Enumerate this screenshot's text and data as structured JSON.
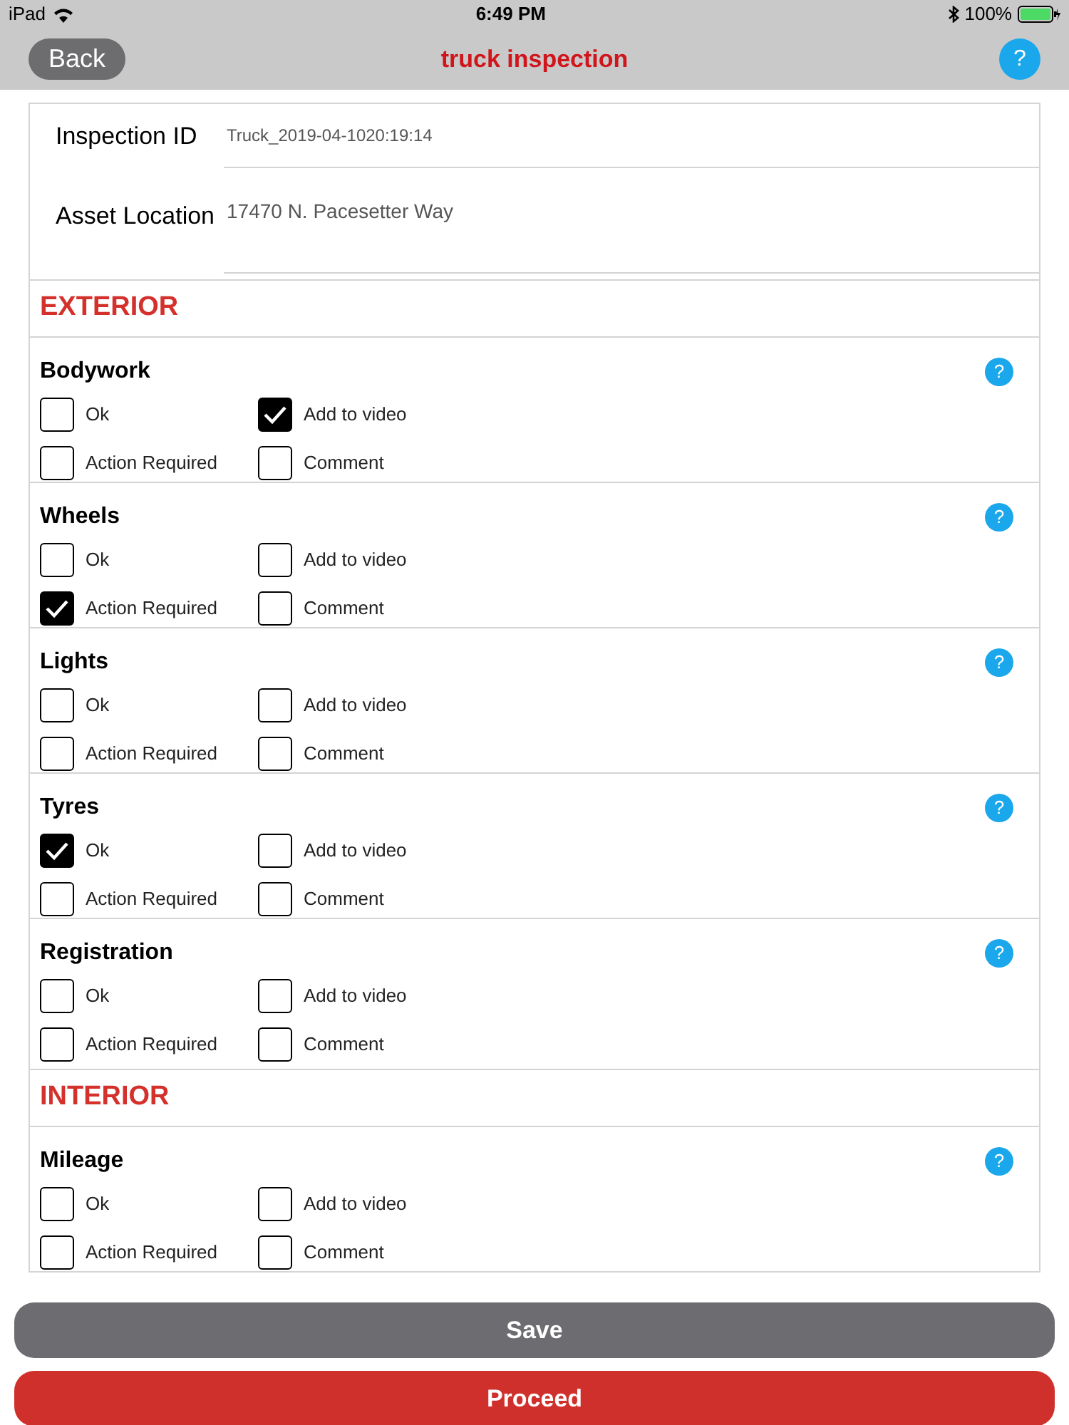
{
  "status_bar": {
    "device": "iPad",
    "time": "6:49 PM",
    "battery": "100%"
  },
  "nav": {
    "back": "Back",
    "title": "truck inspection",
    "help": "?"
  },
  "fields": [
    {
      "label": "Inspection ID",
      "value": "Truck_2019-04-1020:19:14"
    },
    {
      "label": "Asset Location",
      "value": "17470 N. Pacesetter Way"
    }
  ],
  "sections": [
    {
      "title": "EXTERIOR",
      "items": [
        {
          "name": "Bodywork",
          "help": "?",
          "options": [
            {
              "label": "Ok",
              "checked": false
            },
            {
              "label": "Add to video",
              "checked": true
            },
            {
              "label": "Action Required",
              "checked": false
            },
            {
              "label": "Comment",
              "checked": false
            }
          ]
        },
        {
          "name": "Wheels",
          "help": "?",
          "options": [
            {
              "label": "Ok",
              "checked": false
            },
            {
              "label": "Add to video",
              "checked": false
            },
            {
              "label": "Action Required",
              "checked": true
            },
            {
              "label": "Comment",
              "checked": false
            }
          ]
        },
        {
          "name": "Lights",
          "help": "?",
          "options": [
            {
              "label": "Ok",
              "checked": false
            },
            {
              "label": "Add to video",
              "checked": false
            },
            {
              "label": "Action Required",
              "checked": false
            },
            {
              "label": "Comment",
              "checked": false
            }
          ]
        },
        {
          "name": "Tyres",
          "help": "?",
          "options": [
            {
              "label": "Ok",
              "checked": true
            },
            {
              "label": "Add to video",
              "checked": false
            },
            {
              "label": "Action Required",
              "checked": false
            },
            {
              "label": "Comment",
              "checked": false
            }
          ]
        },
        {
          "name": "Registration",
          "help": "?",
          "options": [
            {
              "label": "Ok",
              "checked": false
            },
            {
              "label": "Add to video",
              "checked": false
            },
            {
              "label": "Action Required",
              "checked": false
            },
            {
              "label": "Comment",
              "checked": false
            }
          ]
        }
      ]
    },
    {
      "title": "INTERIOR",
      "items": [
        {
          "name": "Mileage",
          "help": "?",
          "options": [
            {
              "label": "Ok",
              "checked": false
            },
            {
              "label": "Add to video",
              "checked": false
            },
            {
              "label": "Action Required",
              "checked": false
            },
            {
              "label": "Comment",
              "checked": false
            }
          ]
        }
      ]
    }
  ],
  "buttons": [
    {
      "label": "Save",
      "kind": "secondary"
    },
    {
      "label": "Proceed",
      "kind": "primary"
    }
  ]
}
